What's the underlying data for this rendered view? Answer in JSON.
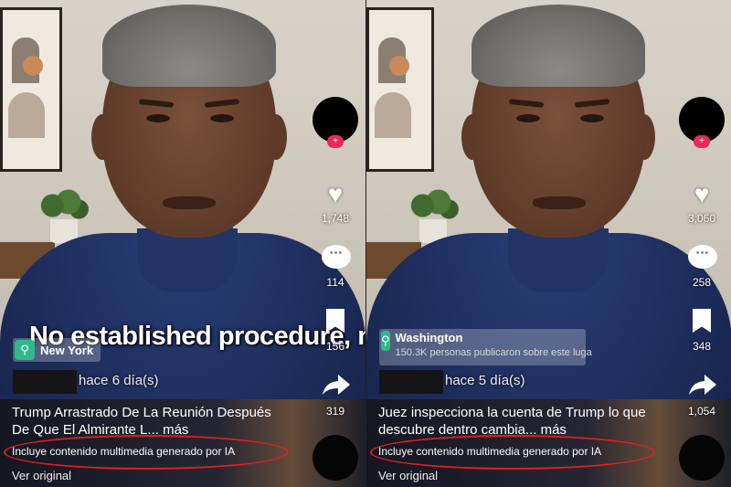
{
  "left": {
    "caption": "No established procedure, no",
    "location_name": "New York",
    "time_ago": "hace 6 día(s)",
    "description": "Trump Arrastrado De La Reunión Después De Que El Almirante L... más",
    "ai_label": "Incluye contenido multimedia generado por IA",
    "view_original": "Ver original",
    "likes": "1,748",
    "comments": "114",
    "saves": "156",
    "shares": "319"
  },
  "right": {
    "location_name": "Washington",
    "location_sub": "150.3K personas publicaron sobre este luga",
    "time_ago": "hace 5 día(s)",
    "description": "Juez inspecciona la cuenta de Trump lo que descubre dentro cambia... más",
    "ai_label": "Incluye contenido multimedia generado por IA",
    "view_original": "Ver original",
    "likes": "3,060",
    "comments": "258",
    "saves": "348",
    "shares": "1,054"
  },
  "icons": {
    "like": "heart-icon",
    "comment": "comment-bubble-icon",
    "save": "bookmark-icon",
    "share": "share-arrow-icon",
    "location": "location-pin-icon",
    "follow": "plus-icon"
  },
  "colors": {
    "highlight_oval": "#e0201c",
    "location_badge": "#2fb88a",
    "follow_badge": "#ea2a55"
  }
}
